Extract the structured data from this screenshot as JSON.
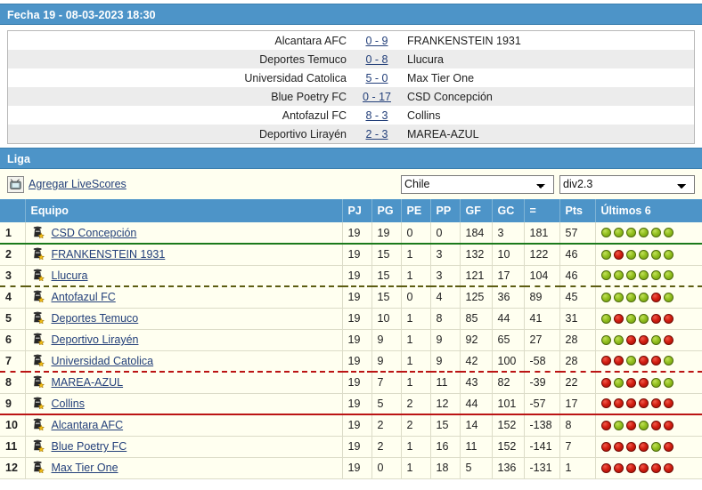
{
  "fecha": {
    "bar_title": "Fecha 19 - 08-03-2023 18:30",
    "matches": [
      {
        "home": "Alcantara AFC",
        "score": "0 - 9",
        "away": "FRANKENSTEIN 1931"
      },
      {
        "home": "Deportes Temuco",
        "score": "0 - 8",
        "away": "Llucura"
      },
      {
        "home": "Universidad Catolica",
        "score": "5 - 0",
        "away": "Max Tier One"
      },
      {
        "home": "Blue Poetry FC",
        "score": "0 - 17",
        "away": "CSD Concepción"
      },
      {
        "home": "Antofazul FC",
        "score": "8 - 3",
        "away": "Collins"
      },
      {
        "home": "Deportivo Lirayén",
        "score": "2 - 3",
        "away": "MAREA-AZUL"
      }
    ]
  },
  "liga": {
    "bar_title": "Liga",
    "livescores_label": "Agregar LiveScores",
    "tv_icon": "tv-icon",
    "country_select": {
      "value": "Chile",
      "options": [
        "Chile"
      ]
    },
    "division_select": {
      "value": "div2.3",
      "options": [
        "div2.3"
      ]
    }
  },
  "table": {
    "headers": {
      "rank": "",
      "team": "Equipo",
      "pj": "PJ",
      "pg": "PG",
      "pe": "PE",
      "pp": "PP",
      "gf": "GF",
      "gc": "GC",
      "diff": "=",
      "pts": "Pts",
      "form": "Últimos 6"
    },
    "rows": [
      {
        "rank": "1",
        "team": "CSD Concepción",
        "pj": "19",
        "pg": "19",
        "pe": "0",
        "pp": "0",
        "gf": "184",
        "gc": "3",
        "diff": "181",
        "pts": "57",
        "form": [
          "W",
          "W",
          "W",
          "W",
          "W",
          "W"
        ],
        "sep": "sep-green"
      },
      {
        "rank": "2",
        "team": "FRANKENSTEIN 1931",
        "pj": "19",
        "pg": "15",
        "pe": "1",
        "pp": "3",
        "gf": "132",
        "gc": "10",
        "diff": "122",
        "pts": "46",
        "form": [
          "W",
          "L",
          "W",
          "W",
          "W",
          "W"
        ],
        "sep": ""
      },
      {
        "rank": "3",
        "team": "Llucura",
        "pj": "19",
        "pg": "15",
        "pe": "1",
        "pp": "3",
        "gf": "121",
        "gc": "17",
        "diff": "104",
        "pts": "46",
        "form": [
          "W",
          "W",
          "W",
          "W",
          "W",
          "W"
        ],
        "sep": "sep-olive"
      },
      {
        "rank": "4",
        "team": "Antofazul FC",
        "pj": "19",
        "pg": "15",
        "pe": "0",
        "pp": "4",
        "gf": "125",
        "gc": "36",
        "diff": "89",
        "pts": "45",
        "form": [
          "W",
          "W",
          "W",
          "W",
          "L",
          "W"
        ],
        "sep": ""
      },
      {
        "rank": "5",
        "team": "Deportes Temuco",
        "pj": "19",
        "pg": "10",
        "pe": "1",
        "pp": "8",
        "gf": "85",
        "gc": "44",
        "diff": "41",
        "pts": "31",
        "form": [
          "W",
          "L",
          "W",
          "W",
          "L",
          "L"
        ],
        "sep": ""
      },
      {
        "rank": "6",
        "team": "Deportivo Lirayén",
        "pj": "19",
        "pg": "9",
        "pe": "1",
        "pp": "9",
        "gf": "92",
        "gc": "65",
        "diff": "27",
        "pts": "28",
        "form": [
          "W",
          "W",
          "L",
          "L",
          "W",
          "L"
        ],
        "sep": ""
      },
      {
        "rank": "7",
        "team": "Universidad Catolica",
        "pj": "19",
        "pg": "9",
        "pe": "1",
        "pp": "9",
        "gf": "42",
        "gc": "100",
        "diff": "-58",
        "pts": "28",
        "form": [
          "L",
          "L",
          "W",
          "L",
          "L",
          "W"
        ],
        "sep": "sep-red-dash"
      },
      {
        "rank": "8",
        "team": "MAREA-AZUL",
        "pj": "19",
        "pg": "7",
        "pe": "1",
        "pp": "11",
        "gf": "43",
        "gc": "82",
        "diff": "-39",
        "pts": "22",
        "form": [
          "L",
          "W",
          "L",
          "L",
          "W",
          "W"
        ],
        "sep": ""
      },
      {
        "rank": "9",
        "team": "Collins",
        "pj": "19",
        "pg": "5",
        "pe": "2",
        "pp": "12",
        "gf": "44",
        "gc": "101",
        "diff": "-57",
        "pts": "17",
        "form": [
          "L",
          "L",
          "L",
          "L",
          "L",
          "L"
        ],
        "sep": "sep-red"
      },
      {
        "rank": "10",
        "team": "Alcantara AFC",
        "pj": "19",
        "pg": "2",
        "pe": "2",
        "pp": "15",
        "gf": "14",
        "gc": "152",
        "diff": "-138",
        "pts": "8",
        "form": [
          "L",
          "W",
          "L",
          "W",
          "L",
          "L"
        ],
        "sep": ""
      },
      {
        "rank": "11",
        "team": "Blue Poetry FC",
        "pj": "19",
        "pg": "2",
        "pe": "1",
        "pp": "16",
        "gf": "11",
        "gc": "152",
        "diff": "-141",
        "pts": "7",
        "form": [
          "L",
          "L",
          "L",
          "L",
          "W",
          "L"
        ],
        "sep": ""
      },
      {
        "rank": "12",
        "team": "Max Tier One",
        "pj": "19",
        "pg": "0",
        "pe": "1",
        "pp": "18",
        "gf": "5",
        "gc": "136",
        "diff": "-131",
        "pts": "1",
        "form": [
          "L",
          "L",
          "L",
          "L",
          "L",
          "L"
        ],
        "sep": ""
      }
    ]
  },
  "colors": {
    "bar_blue": "#4d94c8",
    "row_cream": "#fffff0",
    "link_blue": "#24407a",
    "sep_green": "#1b7a1b",
    "sep_olive": "#5d5d12",
    "sep_red": "#bb1414",
    "win_green": "#93c11f",
    "loss_red": "#d41f12"
  }
}
